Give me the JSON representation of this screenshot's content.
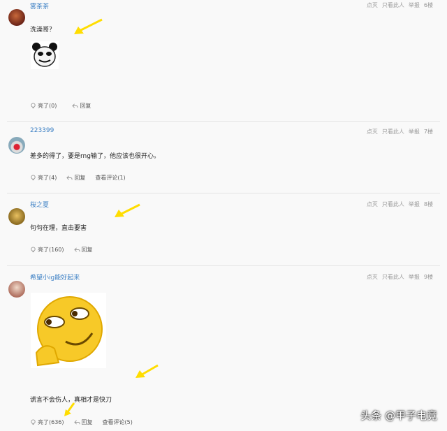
{
  "posts": [
    {
      "user": "雾茶茶",
      "content": "洗澡哥？",
      "floor": "6楼",
      "likes_label": "亮了(0)",
      "reply_label": "回复",
      "comments_label": ""
    },
    {
      "user": "223399",
      "content": "差多的得了，要是rng输了，他应该也很开心。",
      "floor": "7楼",
      "likes_label": "亮了(4)",
      "reply_label": "回复",
      "comments_label": "查看评论(1)"
    },
    {
      "user": "桜之夏",
      "content": "句句在理，直击要害",
      "floor": "8楼",
      "likes_label": "亮了(160)",
      "reply_label": "回复",
      "comments_label": ""
    },
    {
      "user": "希望小ig能好起来",
      "content": "谎言不会伤人，真相才是快刀",
      "floor": "9楼",
      "likes_label": "亮了(636)",
      "reply_label": "回复",
      "comments_label": "查看评论(5)"
    }
  ],
  "meta": {
    "dislike": "点灭",
    "only_this": "只看此人",
    "report": "举报"
  },
  "watermark": "头条 @甲子电竞",
  "colors": {
    "username": "#3b7fc4",
    "arrow": "#ffdd00"
  }
}
